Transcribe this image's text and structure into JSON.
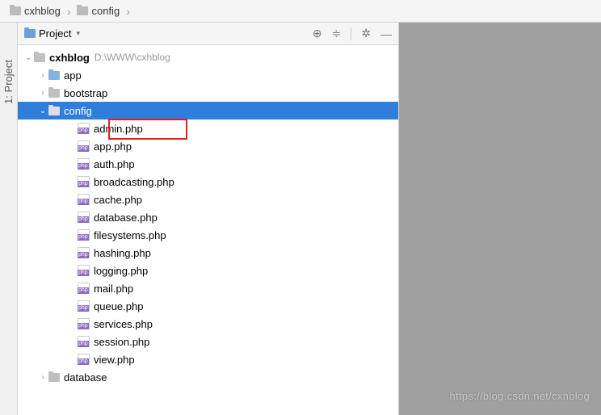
{
  "breadcrumb": [
    {
      "label": "cxhblog"
    },
    {
      "label": "config"
    }
  ],
  "left_tab": {
    "label": "1: Project"
  },
  "panel": {
    "title": "Project"
  },
  "tree": {
    "root": {
      "name": "cxhblog",
      "path": "D:\\WWW\\cxhblog"
    },
    "folders": [
      {
        "name": "app",
        "expanded": false,
        "color": "blue"
      },
      {
        "name": "bootstrap",
        "expanded": false,
        "color": "gray"
      }
    ],
    "config": {
      "name": "config",
      "expanded": true
    },
    "config_files": [
      {
        "name": "admin.php",
        "highlight": true
      },
      {
        "name": "app.php"
      },
      {
        "name": "auth.php"
      },
      {
        "name": "broadcasting.php"
      },
      {
        "name": "cache.php"
      },
      {
        "name": "database.php"
      },
      {
        "name": "filesystems.php"
      },
      {
        "name": "hashing.php"
      },
      {
        "name": "logging.php"
      },
      {
        "name": "mail.php"
      },
      {
        "name": "queue.php"
      },
      {
        "name": "services.php"
      },
      {
        "name": "session.php"
      },
      {
        "name": "view.php"
      }
    ],
    "after": {
      "name": "database",
      "expanded": false,
      "color": "gray"
    }
  },
  "watermark": "https://blog.csdn.net/cxhblog"
}
